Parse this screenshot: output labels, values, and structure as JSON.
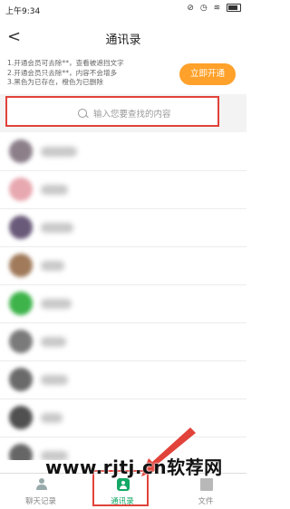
{
  "status": {
    "time": "上午9:34"
  },
  "header": {
    "title": "通讯录",
    "back": "<"
  },
  "notice": {
    "lines": [
      "1.开通会员可去除**，查看被遮挡文字",
      "2.开通会员只去除**，内容不会增多",
      "3.黑色为已存在，橙色为已删除"
    ],
    "button": "立即开通"
  },
  "search": {
    "placeholder": "输入您要查找的内容"
  },
  "contacts": [
    {
      "avatar_color": "#8c7f8a",
      "name_width": 40
    },
    {
      "avatar_color": "#e8a8b0",
      "name_width": 30
    },
    {
      "avatar_color": "#6a5a7a",
      "name_width": 36
    },
    {
      "avatar_color": "#a07a5a",
      "name_width": 26
    },
    {
      "avatar_color": "#3db34a",
      "name_width": 34
    },
    {
      "avatar_color": "#7a7a7a",
      "name_width": 28
    },
    {
      "avatar_color": "#6a6a6a",
      "name_width": 30
    },
    {
      "avatar_color": "#505050",
      "name_width": 24
    },
    {
      "avatar_color": "#666666",
      "name_width": 30
    }
  ],
  "tabs": [
    {
      "label": "聊天记录",
      "icon": "person-icon"
    },
    {
      "label": "通讯录",
      "icon": "contacts-icon"
    },
    {
      "label": "文件",
      "icon": "file-icon"
    }
  ],
  "watermark": "www.rjtj.cn软荐网"
}
